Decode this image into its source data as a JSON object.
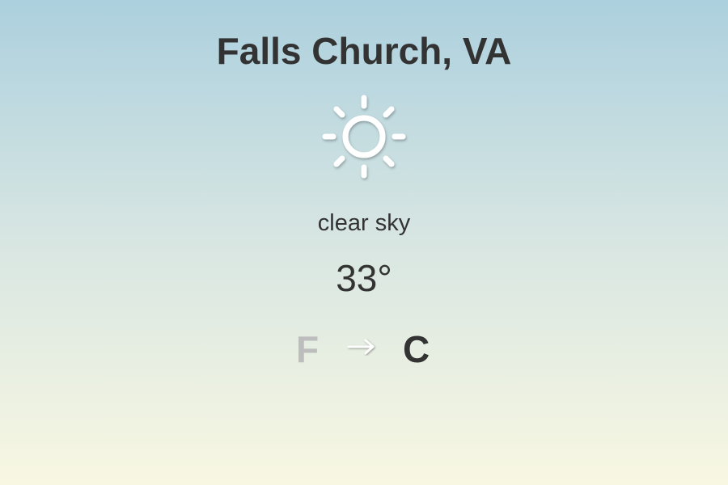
{
  "location": {
    "city": "Falls Church, VA"
  },
  "weather": {
    "icon": "sun-icon",
    "description": "clear sky",
    "temperature": "33°"
  },
  "units": {
    "from_label": "F",
    "to_label": "C",
    "toggle_icon": "arrow-right-icon"
  },
  "colors": {
    "text": "#333333",
    "inactive_unit": "#bdbdbd",
    "icon": "#ffffff",
    "gradient_top": "#acd0de",
    "gradient_bottom": "#f8f7e2"
  }
}
